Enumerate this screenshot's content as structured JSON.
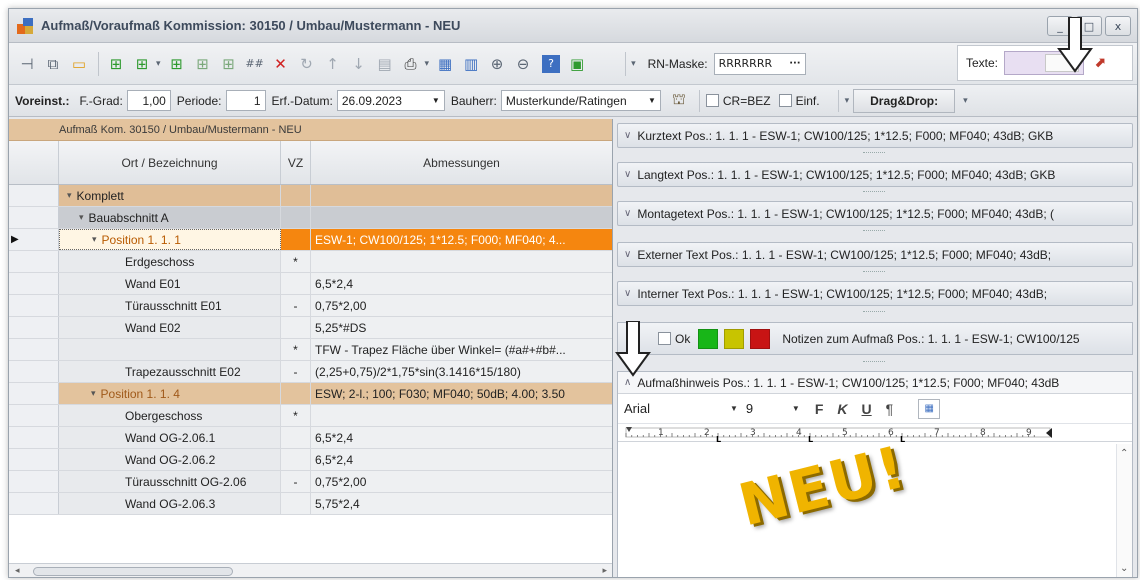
{
  "window": {
    "title": "Aufmaß/Voraufmaß Kommission: 30150 / Umbau/Mustermann - NEU",
    "controls": [
      "_",
      "□",
      "x"
    ]
  },
  "toolbar": {
    "icons": [
      {
        "name": "pin-icon",
        "glyph": "⊣"
      },
      {
        "name": "export-icon",
        "glyph": "⧉"
      },
      {
        "name": "ruler-icon",
        "glyph": "▭"
      },
      {
        "name": "add-position-icon",
        "glyph": "⊞"
      },
      {
        "name": "add-group-icon",
        "glyph": "⊞"
      },
      {
        "name": "insert-row-icon",
        "glyph": "⊞"
      },
      {
        "name": "insert-subrow-icon",
        "glyph": "⊞"
      },
      {
        "name": "insert-row-below-icon",
        "glyph": "⊞"
      },
      {
        "name": "numbering-icon",
        "glyph": "##"
      },
      {
        "name": "delete-icon",
        "glyph": "✕"
      },
      {
        "name": "undo-icon",
        "glyph": "↻"
      },
      {
        "name": "move-up-icon",
        "glyph": "↑"
      },
      {
        "name": "move-down-icon",
        "glyph": "↓"
      },
      {
        "name": "save-icon",
        "glyph": "▤"
      },
      {
        "name": "print-icon",
        "glyph": "⎙"
      },
      {
        "name": "report-icon",
        "glyph": "▦"
      },
      {
        "name": "table-icon",
        "glyph": "▥"
      },
      {
        "name": "zoom-in-icon",
        "glyph": "⊕"
      },
      {
        "name": "zoom-out-icon",
        "glyph": "⊖"
      },
      {
        "name": "help-icon",
        "glyph": "?"
      },
      {
        "name": "image-icon",
        "glyph": "▣"
      }
    ],
    "rn_label": "RN-Maske:",
    "rn_value": "RRRRRRR",
    "rn_button": "···",
    "texte_label": "Texte:",
    "texte_color": "#e8dff2"
  },
  "settings": {
    "voreinst": "Voreinst.:",
    "fgrad_label": "F.-Grad:",
    "fgrad_value": "1,00",
    "periode_label": "Periode:",
    "periode_value": "1",
    "erf_label": "Erf.-Datum:",
    "erf_value": "26.09.2023",
    "bauherr_label": "Bauherr:",
    "bauherr_value": "Musterkunde/Ratingen",
    "cr_label": "CR=BEZ",
    "einf_label": "Einf.",
    "dragdrop_label": "Drag&Drop:"
  },
  "grid": {
    "caption": "Aufmaß Kom. 30150 / Umbau/Mustermann - NEU",
    "columns": {
      "ort": "Ort / Bezeichnung",
      "vz": "VZ",
      "abm": "Abmessungen"
    },
    "rows": [
      {
        "type": "group1",
        "ort": "Komplett",
        "vz": "",
        "abm": ""
      },
      {
        "type": "group2",
        "ort": "Bauabschnitt A",
        "vz": "",
        "abm": ""
      },
      {
        "type": "pos-active",
        "ort": "Position  1.  1.   1",
        "vz": "",
        "abm": "ESW-1; CW100/125; 1*12.5; F000; MF040; 4..."
      },
      {
        "type": "detail",
        "ort": "Erdgeschoss",
        "vz": "*",
        "abm": ""
      },
      {
        "type": "detail",
        "ort": "Wand E01",
        "vz": "",
        "abm": "6,5*2,4"
      },
      {
        "type": "detail",
        "ort": "Türausschnitt E01",
        "vz": "-",
        "abm": "0,75*2,00"
      },
      {
        "type": "detail",
        "ort": "Wand E02",
        "vz": "",
        "abm": "5,25*#DS"
      },
      {
        "type": "detail",
        "ort": "",
        "vz": "*",
        "abm": "TFW - Trapez Fläche über Winkel= (#a#+#b#..."
      },
      {
        "type": "detail",
        "ort": "Trapezausschnitt E02",
        "vz": "-",
        "abm": "(2,25+0,75)/2*1,75*sin(3.1416*15/180)"
      },
      {
        "type": "pos2",
        "ort": "Position  1.  1.   4",
        "vz": "",
        "abm": "ESW; 2-l.; 100; F030; MF040; 50dB; 4.00; 3.50"
      },
      {
        "type": "detail",
        "ort": "Obergeschoss",
        "vz": "*",
        "abm": ""
      },
      {
        "type": "detail",
        "ort": "Wand OG-2.06.1",
        "vz": "",
        "abm": "6,5*2,4"
      },
      {
        "type": "detail",
        "ort": "Wand OG-2.06.2",
        "vz": "",
        "abm": "6,5*2,4"
      },
      {
        "type": "detail",
        "ort": "Türausschnitt OG-2.06",
        "vz": "-",
        "abm": "0,75*2,00"
      },
      {
        "type": "detail",
        "ort": "Wand OG-2.06.3",
        "vz": "",
        "abm": "5,75*2,4"
      }
    ]
  },
  "sections": [
    {
      "label": "Kurztext Pos.:  1.  1.   1   - ESW-1; CW100/125; 1*12.5; F000; MF040; 43dB; GKB"
    },
    {
      "label": "Langtext Pos.:  1.  1.   1   - ESW-1; CW100/125; 1*12.5; F000; MF040; 43dB; GKB"
    },
    {
      "label": "Montagetext Pos.:  1.  1.   1   - ESW-1; CW100/125; 1*12.5; F000; MF040; 43dB; ("
    },
    {
      "label": "Externer Text Pos.:  1.  1.   1   - ESW-1; CW100/125; 1*12.5; F000; MF040; 43dB;"
    },
    {
      "label": "Interner Text Pos.:  1.  1.   1   - ESW-1; CW100/125; 1*12.5; F000; MF040; 43dB;"
    }
  ],
  "notes": {
    "ok_label": "Ok",
    "colors": [
      "#18b618",
      "#c8c400",
      "#c81414"
    ],
    "label": "Notizen zum Aufmaß Pos.:  1.  1.   1   - ESW-1; CW100/125"
  },
  "editor": {
    "header": "Aufmaßhinweis Pos.:  1.  1.   1   - ESW-1; CW100/125; 1*12.5; F000; MF040; 43dB",
    "font": "Arial",
    "size": "9",
    "bold": "F",
    "italic": "K",
    "underline": "U",
    "para": "¶",
    "ruler_numbers": [
      "1",
      "2",
      "3",
      "4",
      "5",
      "6",
      "7",
      "8",
      "9"
    ],
    "stamp": "NEU!"
  }
}
